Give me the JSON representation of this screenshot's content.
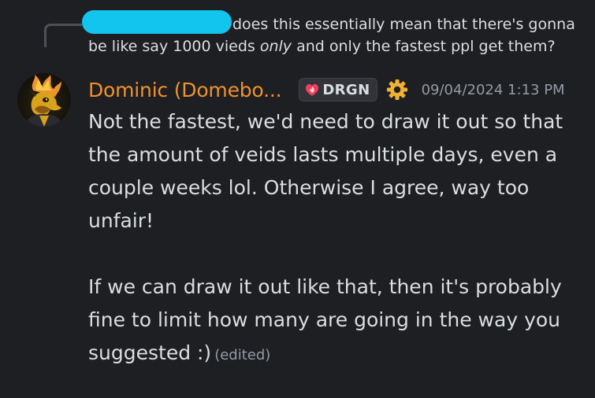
{
  "reply": {
    "text_line1": "does this essentially mean that there's gonna",
    "text_line2_before": "be like say 1000 vieds ",
    "text_line2_emph": "only",
    "text_line2_after": " and only the fastest ppl get them?"
  },
  "message": {
    "username": "Dominic (Domebo...",
    "username_color": "#f0922e",
    "tag_label": "DRGN",
    "tag_icon": "heart-flame-icon",
    "role_icon": "gear-icon",
    "timestamp": "09/04/2024 1:13 PM",
    "paragraph1": "Not the fastest, we'd need to draw it out so that the amount of veids lasts multiple days, even a couple weeks lol. Otherwise I agree, way too unfair!",
    "paragraph2": "If we can draw it out like that, then it's probably fine to limit how many are going in the way you suggested :)",
    "edited_label": "(edited)"
  },
  "colors": {
    "background": "#1e1f22",
    "text": "#dbdee1",
    "muted": "#949ba4",
    "gear": "#f0b232",
    "redaction": "#11c5ee"
  }
}
